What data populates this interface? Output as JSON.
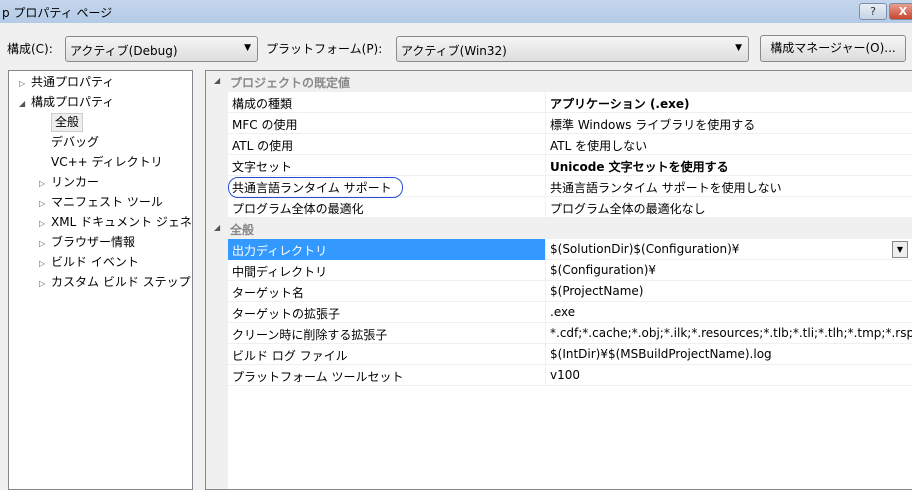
{
  "window": {
    "title": "p プロパティ ページ",
    "help": "?",
    "close": "X"
  },
  "toolbar": {
    "config_label": "構成(C):",
    "config_value": "アクティブ(Debug)",
    "platform_label": "プラットフォーム(P):",
    "platform_value": "アクティブ(Win32)",
    "manager_button": "構成マネージャー(O)..."
  },
  "tree": [
    {
      "label": "共通プロパティ",
      "toggle": "▷"
    },
    {
      "label": "構成プロパティ",
      "toggle": "◢"
    },
    {
      "label": "全般",
      "toggle": ""
    },
    {
      "label": "デバッグ",
      "toggle": ""
    },
    {
      "label": "VC++ ディレクトリ",
      "toggle": ""
    },
    {
      "label": "リンカー",
      "toggle": "▷"
    },
    {
      "label": "マニフェスト ツール",
      "toggle": "▷"
    },
    {
      "label": "XML ドキュメント ジェネ",
      "toggle": "▷"
    },
    {
      "label": "ブラウザー情報",
      "toggle": "▷"
    },
    {
      "label": "ビルド イベント",
      "toggle": "▷"
    },
    {
      "label": "カスタム ビルド ステップ",
      "toggle": "▷"
    }
  ],
  "groups": [
    {
      "title": "プロジェクトの既定値",
      "rows": [
        {
          "name": "構成の種類",
          "value": "アプリケーション (.exe)"
        },
        {
          "name": "MFC の使用",
          "value": "標準 Windows ライブラリを使用する"
        },
        {
          "name": "ATL の使用",
          "value": "ATL を使用しない"
        },
        {
          "name": "文字セット",
          "value": "Unicode 文字セットを使用する"
        },
        {
          "name": "共通言語ランタイム サポート",
          "value": "共通言語ランタイム サポートを使用しない"
        },
        {
          "name": "プログラム全体の最適化",
          "value": "プログラム全体の最適化なし"
        }
      ]
    },
    {
      "title": "全般",
      "rows": [
        {
          "name": "出力ディレクトリ",
          "value": "$(SolutionDir)$(Configuration)¥"
        },
        {
          "name": "中間ディレクトリ",
          "value": "$(Configuration)¥"
        },
        {
          "name": "ターゲット名",
          "value": "$(ProjectName)"
        },
        {
          "name": "ターゲットの拡張子",
          "value": ".exe"
        },
        {
          "name": "クリーン時に削除する拡張子",
          "value": "*.cdf;*.cache;*.obj;*.ilk;*.resources;*.tlb;*.tli;*.tlh;*.tmp;*.rsp"
        },
        {
          "name": "ビルド ログ ファイル",
          "value": "$(IntDir)¥$(MSBuildProjectName).log"
        },
        {
          "name": "プラットフォーム ツールセット",
          "value": "v100"
        }
      ]
    }
  ]
}
